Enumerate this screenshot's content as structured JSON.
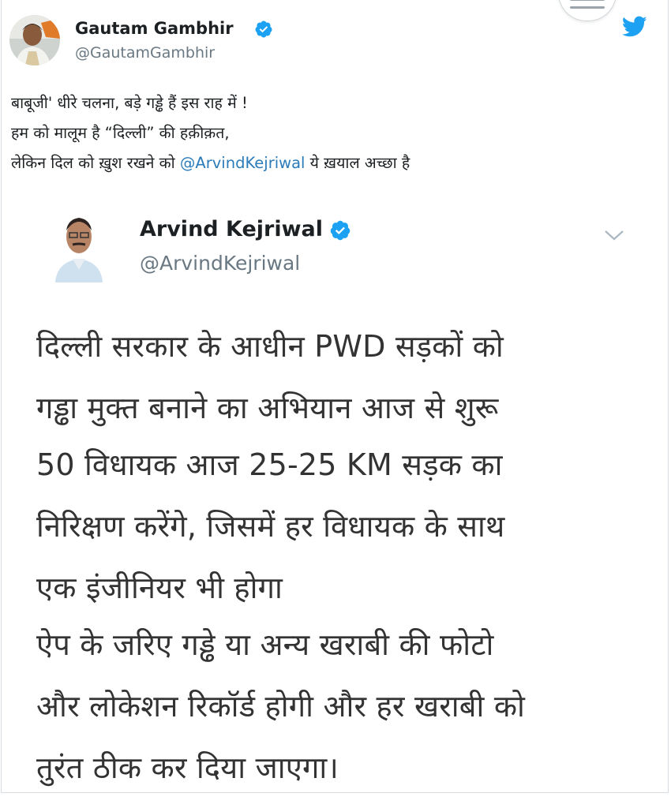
{
  "tweet": {
    "author_name": "Gautam Gambhir",
    "author_handle": "@GautamGambhir",
    "text_lines": [
      "बाबूजी' धीरे चलना, बड़े गड्ढे हैं इस राह में !",
      "हम को मालूम है “दिल्ली” की हक़ीक़त,"
    ],
    "line3_prefix": "लेकिन दिल को ख़ुश रखने को ",
    "line3_mention": "@ArvindKejriwal",
    "line3_suffix": " ये ख़याल अच्छा है"
  },
  "quoted": {
    "author_name": "Arvind Kejriwal",
    "author_handle": "@ArvindKejriwal",
    "paragraphs": [
      [
        "दिल्ली सरकार के आधीन PWD सड़कों को",
        "गड्ढा मुक्त बनाने का अभियान आज से शुरू"
      ],
      [
        "50 विधायक आज 25-25 KM सड़क का",
        "निरिक्षण करेंगे, जिसमें हर विधायक के साथ",
        "एक इंजीनियर भी होगा"
      ],
      [
        "ऐप के जरिए गड्ढे या अन्य खराबी की फोटो",
        "और लोकेशन रिकॉर्ड होगी और हर खराबी को",
        "तुरंत ठीक कर दिया जाएगा।"
      ]
    ]
  },
  "icons": {
    "verified": "verified-badge-icon",
    "twitter": "twitter-bird-icon",
    "menu": "hamburger-menu-icon",
    "chevron": "chevron-down-icon"
  },
  "colors": {
    "verified": "#1da1f2",
    "twitter": "#1da1f2",
    "mention": "#2b7bb9",
    "handle": "#697882"
  }
}
